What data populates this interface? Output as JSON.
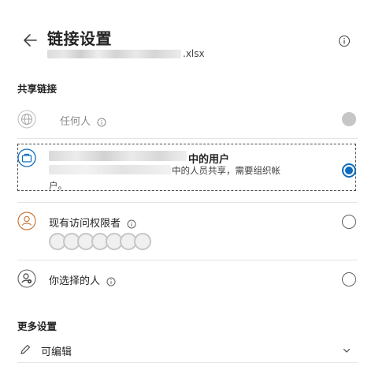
{
  "header": {
    "title": "链接设置",
    "filename_visible": ".xlsx"
  },
  "sharing": {
    "section_title": "共享链接",
    "options": [
      {
        "label": "任何人",
        "state": "disabled"
      },
      {
        "label": "中的用户",
        "description_line1": "中的人员共享，需要组织帐",
        "description_line2": "户。",
        "state": "selected"
      },
      {
        "label": "现有访问权限者",
        "state": "unselected"
      },
      {
        "label": "你选择的人",
        "state": "unselected"
      }
    ]
  },
  "more_settings": {
    "section_title": "更多设置",
    "permission_value": "可编辑"
  },
  "colors": {
    "accent": "#0f6cbd",
    "text": "#242424",
    "disabled_text": "#8a8a8a",
    "radio_border": "#616161",
    "icon_orange": "#c8793d"
  },
  "icons": {
    "back": "arrow-left-icon",
    "info": "info-icon",
    "anyone": "globe-icon",
    "org": "briefcase-icon",
    "existing": "person-check-icon",
    "specific": "person-gear-icon",
    "edit": "pencil-icon",
    "dropdown": "chevron-down-icon"
  }
}
